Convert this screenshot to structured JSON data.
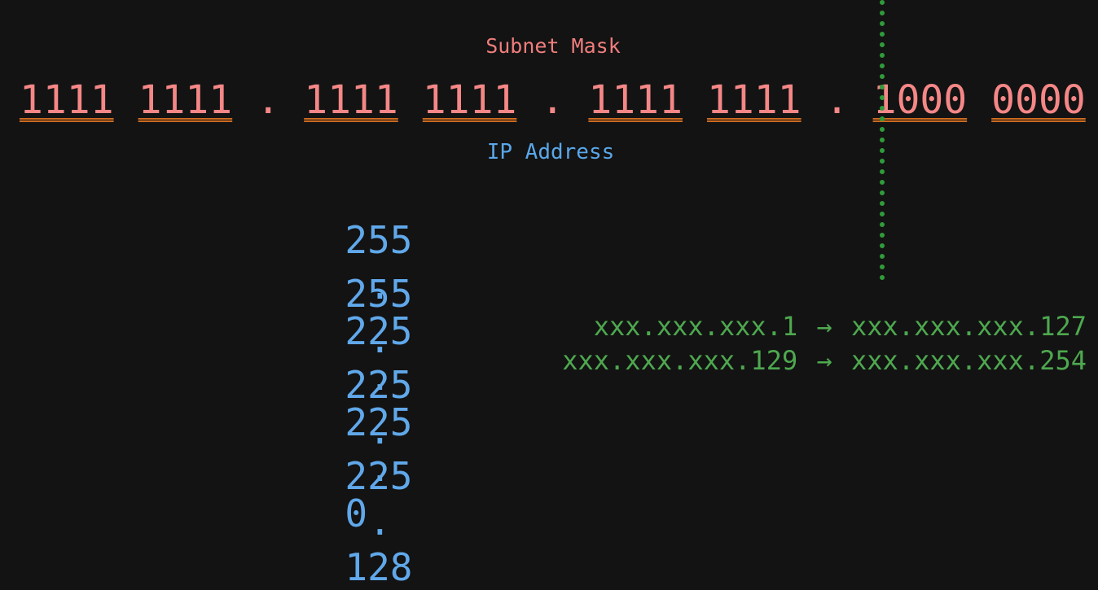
{
  "subnet_label": "Subnet Mask",
  "mask_groups": [
    "1111",
    "1111",
    "1111",
    "1111",
    "1111",
    "1111",
    "1000",
    "0000"
  ],
  "mask_separator": ".",
  "ip_label": "IP Address",
  "ip_rows": [
    [
      "255",
      "225",
      "225",
      "0"
    ],
    [
      "255",
      "225",
      "225",
      "128"
    ]
  ],
  "ip_separator": ".",
  "ranges": [
    {
      "start": "xxx.xxx.xxx.1",
      "arrow": "→",
      "end": "xxx.xxx.xxx.127"
    },
    {
      "start": "xxx.xxx.xxx.129",
      "arrow": "→",
      "end": "xxx.xxx.xxx.254"
    }
  ],
  "colors": {
    "background": "#131313",
    "mask": "#f58787",
    "mask_underline": "#cd6b1e",
    "ip": "#60a8ea",
    "range": "#4ea84f",
    "divider": "#2f9c3a"
  }
}
